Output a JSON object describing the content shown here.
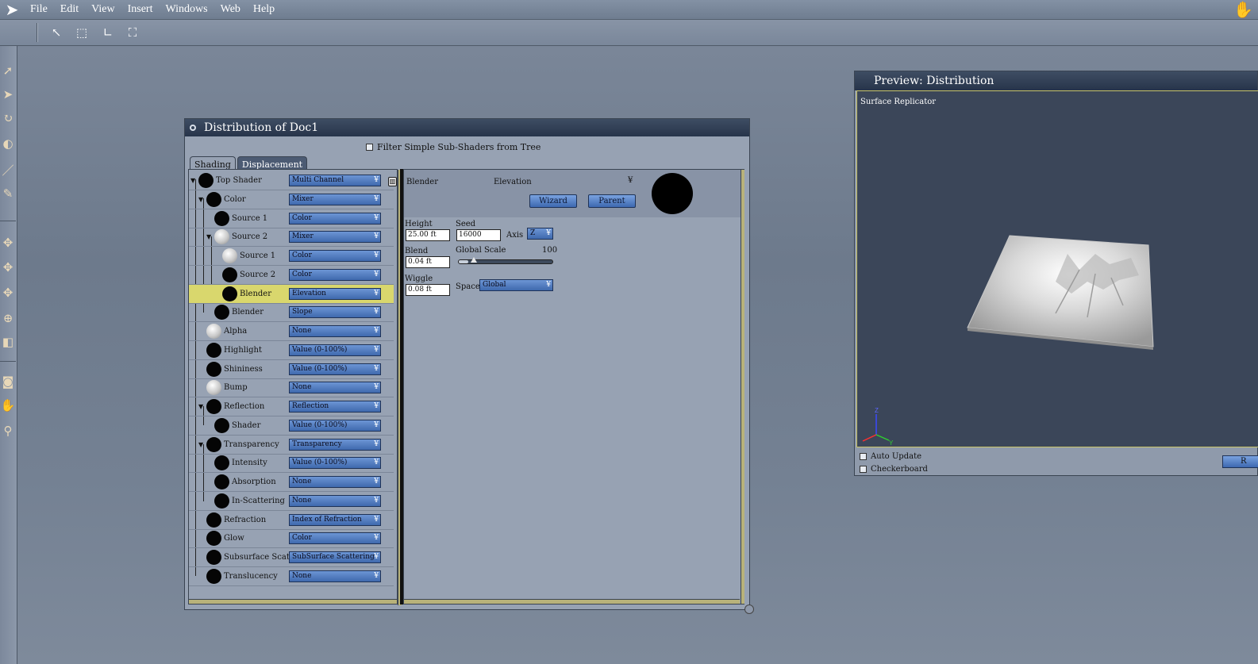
{
  "menubar": {
    "items": [
      "File",
      "Edit",
      "View",
      "Insert",
      "Windows",
      "Web",
      "Help"
    ]
  },
  "toolbar": {
    "tools": [
      "pointer-icon",
      "move-icon",
      "rotate-icon",
      "resize-icon"
    ]
  },
  "distribution_window": {
    "title": "Distribution of Doc1",
    "filter_label": "Filter Simple Sub-Shaders from Tree",
    "tabs": [
      {
        "label": "Shading",
        "active": true
      },
      {
        "label": "Displacement",
        "active": false
      }
    ],
    "tree": [
      {
        "label": "Top Shader",
        "value": "Multi Channel",
        "ball": "black"
      },
      {
        "label": "Color",
        "value": "Mixer",
        "ball": "black"
      },
      {
        "label": "Source 1",
        "value": "Color",
        "ball": "black"
      },
      {
        "label": "Source 2",
        "value": "Mixer",
        "ball": "white"
      },
      {
        "label": "Source 1",
        "value": "Color",
        "ball": "white"
      },
      {
        "label": "Source 2",
        "value": "Color",
        "ball": "black"
      },
      {
        "label": "Blender",
        "value": "Elevation",
        "ball": "black",
        "selected": true
      },
      {
        "label": "Blender",
        "value": "Slope",
        "ball": "black"
      },
      {
        "label": "Alpha",
        "value": "None",
        "ball": "white"
      },
      {
        "label": "Highlight",
        "value": "Value (0-100%)",
        "ball": "black"
      },
      {
        "label": "Shininess",
        "value": "Value (0-100%)",
        "ball": "black"
      },
      {
        "label": "Bump",
        "value": "None",
        "ball": "white"
      },
      {
        "label": "Reflection",
        "value": "Reflection",
        "ball": "black"
      },
      {
        "label": "Shader",
        "value": "Value (0-100%)",
        "ball": "black"
      },
      {
        "label": "Transparency",
        "value": "Transparency",
        "ball": "black"
      },
      {
        "label": "Intensity",
        "value": "Value (0-100%)",
        "ball": "black"
      },
      {
        "label": "Absorption",
        "value": "None",
        "ball": "black"
      },
      {
        "label": "In-Scattering",
        "value": "None",
        "ball": "black"
      },
      {
        "label": "Refraction",
        "value": "Index of Refraction",
        "ball": "black"
      },
      {
        "label": "Glow",
        "value": "Color",
        "ball": "black"
      },
      {
        "label": "Subsurface Scat",
        "value": "SubSurface Scattering",
        "ball": "black"
      },
      {
        "label": "Translucency",
        "value": "None",
        "ball": "black"
      }
    ],
    "detail": {
      "header_left": "Blender",
      "header_right": "Elevation",
      "wizard_label": "Wizard",
      "parent_label": "Parent",
      "height_label": "Height",
      "height_value": "25.00 ft",
      "seed_label": "Seed",
      "seed_value": "16000",
      "axis_label": "Axis",
      "axis_value": "Z",
      "blend_label": "Blend",
      "blend_value": "0.04 ft",
      "global_scale_label": "Global Scale",
      "global_scale_value": "100",
      "global_scale_fraction": 0.1,
      "wiggle_label": "Wiggle",
      "wiggle_value": "0.08 ft",
      "space_label": "Space",
      "space_value": "Global"
    }
  },
  "preview_window": {
    "title": "Preview: Distribution",
    "view_label": "Surface Replicator",
    "auto_update_label": "Auto Update",
    "checkerboard_label": "Checkerboard",
    "button_label": "R"
  },
  "colors": {
    "title_bar": "#27344a",
    "dropdown_blue": "#3f69ad",
    "selection_yellow": "#d9d76d"
  }
}
